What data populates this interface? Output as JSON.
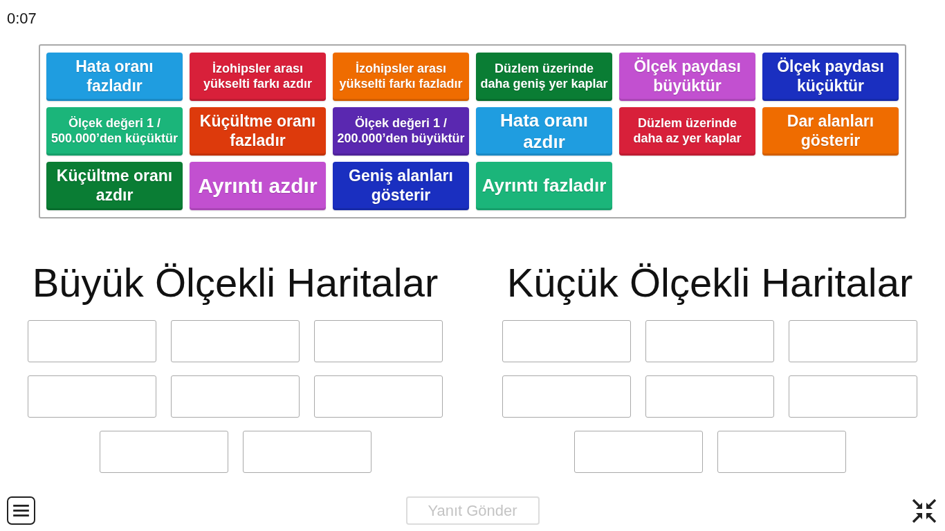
{
  "timer": "0:07",
  "tiles": [
    {
      "text": "Hata oranı fazladır",
      "color": "#1f9de0"
    },
    {
      "text": "İzohipsler arası yükselti farkı azdır",
      "color": "#d8203a"
    },
    {
      "text": "İzohipsler arası yükselti farkı fazladır",
      "color": "#ef6c00"
    },
    {
      "text": "Düzlem üzerinde daha geniş yer kaplar",
      "color": "#0a7d34"
    },
    {
      "text": "Ölçek paydası büyüktür",
      "color": "#c250d0"
    },
    {
      "text": "Ölçek paydası küçüktür",
      "color": "#1a2fc0"
    },
    {
      "text": "Ölçek değeri 1 / 500.000’den küçüktür",
      "color": "#1bb57a"
    },
    {
      "text": "Küçültme oranı fazladır",
      "color": "#dd3a0c"
    },
    {
      "text": "Ölçek değeri 1 / 200.000’den büyüktür",
      "color": "#5a28b0"
    },
    {
      "text": "Hata oranı azdır",
      "color": "#1f9de0"
    },
    {
      "text": "Düzlem üzerinde daha az yer kaplar",
      "color": "#d8203a"
    },
    {
      "text": "Dar alanları gösterir",
      "color": "#ef6c00"
    },
    {
      "text": "Küçültme oranı azdır",
      "color": "#0a7d34"
    },
    {
      "text": "Ayrıntı azdır",
      "color": "#c250d0"
    },
    {
      "text": "Geniş alanları gösterir",
      "color": "#1a2fc0"
    },
    {
      "text": "Ayrıntı fazladır",
      "color": "#1bb57a"
    }
  ],
  "groups": [
    {
      "title": "Büyük Ölçekli Haritalar",
      "slots": [
        {
          "filled": false
        },
        {
          "filled": false
        },
        {
          "filled": false
        },
        {
          "filled": false
        },
        {
          "filled": false
        },
        {
          "filled": false
        },
        {
          "filled": false
        },
        {
          "filled": false
        }
      ]
    },
    {
      "title": "Küçük Ölçekli Haritalar",
      "slots": [
        {
          "filled": false
        },
        {
          "filled": false
        },
        {
          "filled": false
        },
        {
          "filled": false
        },
        {
          "filled": false
        },
        {
          "filled": false
        },
        {
          "filled": false
        },
        {
          "filled": false
        }
      ]
    }
  ],
  "submit_button": {
    "label": "Yanıt Gönder",
    "disabled": true
  }
}
